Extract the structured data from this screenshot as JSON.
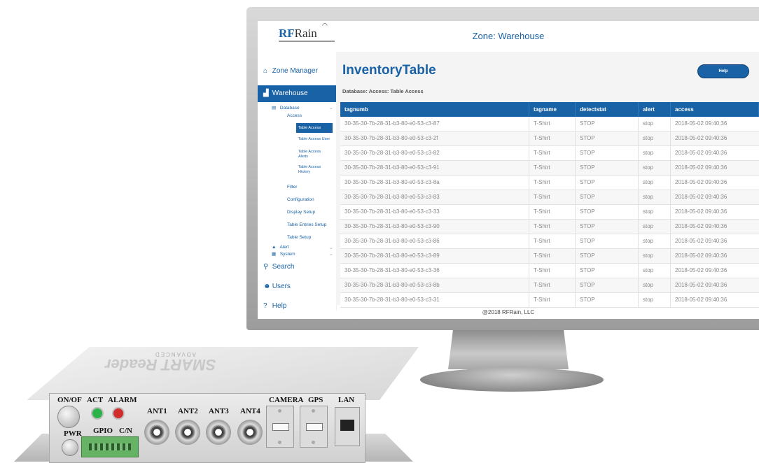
{
  "app": {
    "logo_rf": "RF",
    "logo_rain": "Rain",
    "zone_title": "Zone: Warehouse",
    "footer": "@2018 RFRain, LLC"
  },
  "sidebar": {
    "zone_manager": "Zone Manager",
    "warehouse": "Warehouse",
    "database": "Database",
    "access": "Access",
    "table_access": "Table Access",
    "table_access_user": "Table Access User",
    "table_access_alerts": "Table Access Alerts",
    "table_access_history": "Table Access History",
    "filter": "Filter",
    "configuration": "Configuration",
    "display_setup": "Display Setup",
    "table_entries_setup": "Table Entries Setup",
    "table_setup": "Table Setup",
    "alert": "Alert",
    "system": "System",
    "search": "Search",
    "users": "Users",
    "help": "Help"
  },
  "main": {
    "title": "InventoryTable",
    "help_button": "Help",
    "breadcrumb": "Database: Access: Table Access"
  },
  "table": {
    "columns": [
      "tagnumb",
      "tagname",
      "detectstat",
      "alert",
      "access"
    ],
    "rows": [
      [
        "30-35-30-7b-28-31-b3-80-e0-53-c3-87",
        "T-Shirt",
        "STOP",
        "stop",
        "2018-05-02 09:40:36"
      ],
      [
        "30-35-30-7b-28-31-b3-80-e0-53-c3-2f",
        "T-Shirt",
        "STOP",
        "stop",
        "2018-05-02 09:40:36"
      ],
      [
        "30-35-30-7b-28-31-b3-80-e0-53-c3-82",
        "T-Shirt",
        "STOP",
        "stop",
        "2018-05-02 09:40:36"
      ],
      [
        "30-35-30-7b-28-31-b3-80-e0-53-c3-91",
        "T-Shirt",
        "STOP",
        "stop",
        "2018-05-02 09:40:36"
      ],
      [
        "30-35-30-7b-28-31-b3-80-e0-53-c3-8a",
        "T-Shirt",
        "STOP",
        "stop",
        "2018-05-02 09:40:36"
      ],
      [
        "30-35-30-7b-28-31-b3-80-e0-53-c3-83",
        "T-Shirt",
        "STOP",
        "stop",
        "2018-05-02 09:40:36"
      ],
      [
        "30-35-30-7b-28-31-b3-80-e0-53-c3-33",
        "T-Shirt",
        "STOP",
        "stop",
        "2018-05-02 09:40:36"
      ],
      [
        "30-35-30-7b-28-31-b3-80-e0-53-c3-90",
        "T-Shirt",
        "STOP",
        "stop",
        "2018-05-02 09:40:36"
      ],
      [
        "30-35-30-7b-28-31-b3-80-e0-53-c3-86",
        "T-Shirt",
        "STOP",
        "stop",
        "2018-05-02 09:40:36"
      ],
      [
        "30-35-30-7b-28-31-b3-80-e0-53-c3-89",
        "T-Shirt",
        "STOP",
        "stop",
        "2018-05-02 09:40:36"
      ],
      [
        "30-35-30-7b-28-31-b3-80-e0-53-c3-36",
        "T-Shirt",
        "STOP",
        "stop",
        "2018-05-02 09:40:36"
      ],
      [
        "30-35-30-7b-28-31-b3-80-e0-53-c3-8b",
        "T-Shirt",
        "STOP",
        "stop",
        "2018-05-02 09:40:36"
      ],
      [
        "30-35-30-7b-28-31-b3-80-e0-53-c3-31",
        "T-Shirt",
        "STOP",
        "stop",
        "2018-05-02 09:40:36"
      ]
    ]
  },
  "device": {
    "brand_line1": "SMART Reader",
    "brand_line2": "ADVANCED",
    "on_off": "ON/OF",
    "act": "ACT",
    "alarm": "ALARM",
    "pwr": "PWR",
    "gpio": "GPIO",
    "cn": "C/N",
    "ant1": "ANT1",
    "ant2": "ANT2",
    "ant3": "ANT3",
    "ant4": "ANT4",
    "camera": "CAMERA",
    "gps": "GPS",
    "lan": "LAN",
    "act_color": "#2bb34a",
    "alarm_color": "#d22b2b"
  },
  "colors": {
    "accent": "#1a62a6"
  }
}
